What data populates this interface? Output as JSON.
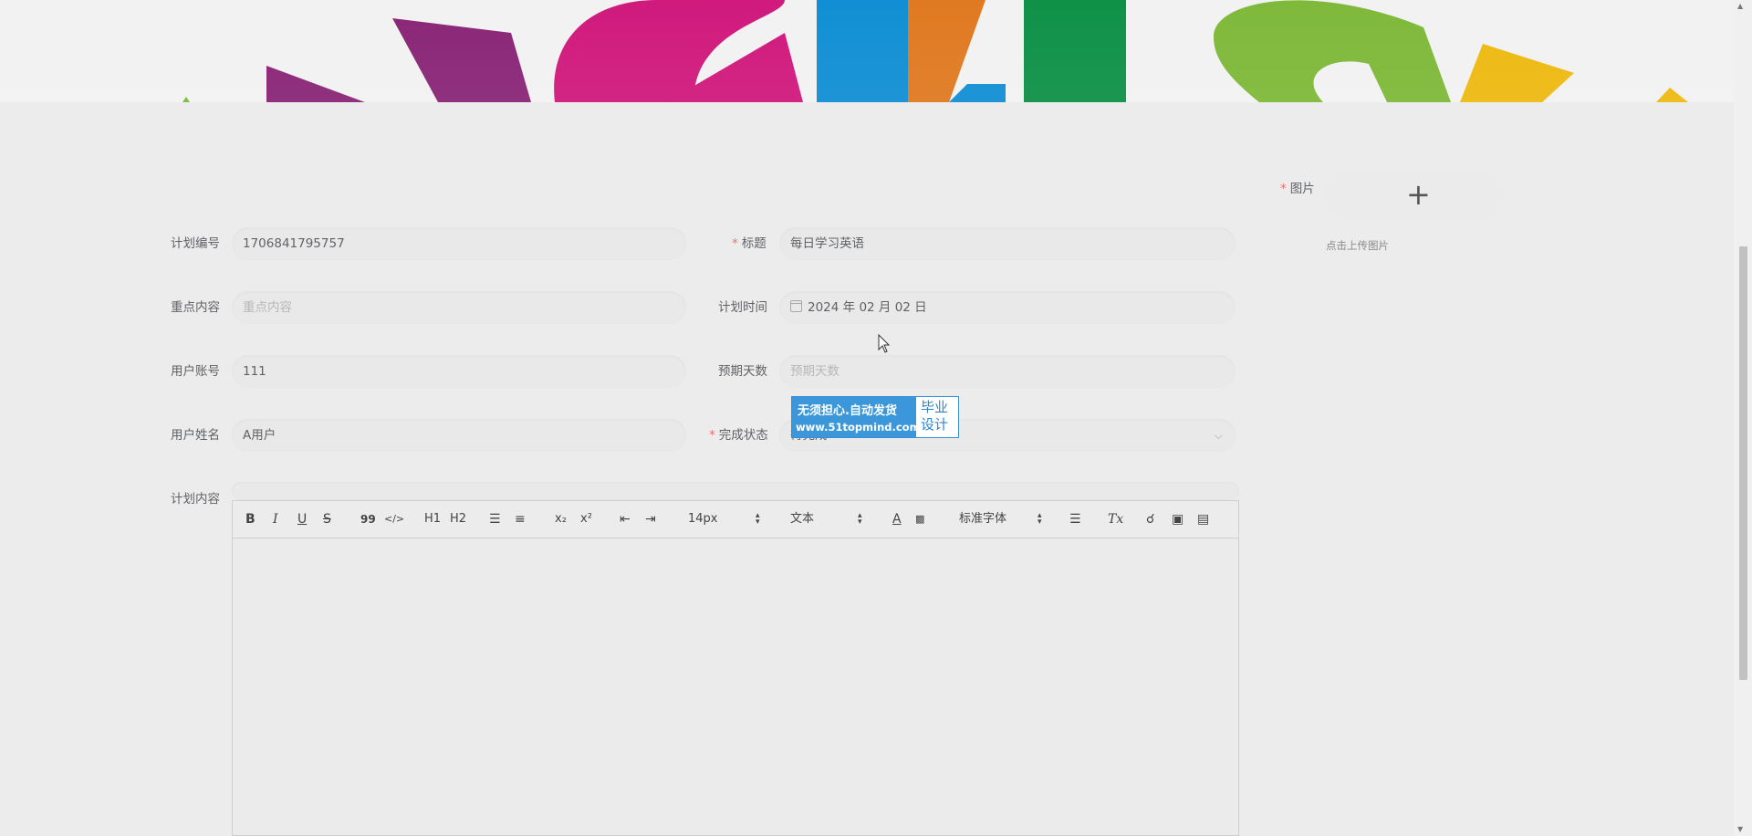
{
  "form": {
    "plan_no": {
      "label": "计划编号",
      "value": "1706841795757"
    },
    "title": {
      "label": "标题",
      "value": "每日学习英语",
      "required": true
    },
    "key_content": {
      "label": "重点内容",
      "placeholder": "重点内容"
    },
    "plan_time": {
      "label": "计划时间",
      "value": "2024 年 02 月 02 日"
    },
    "user_account": {
      "label": "用户账号",
      "value": "111"
    },
    "expected_days": {
      "label": "预期天数",
      "placeholder": "预期天数"
    },
    "user_name": {
      "label": "用户姓名",
      "value": "A用户"
    },
    "status": {
      "label": "完成状态",
      "value": "待完成",
      "required": true
    },
    "image": {
      "label": "图片",
      "required": true,
      "plus": "+",
      "hint": "点击上传图片"
    },
    "plan_content": {
      "label": "计划内容"
    }
  },
  "editor_toolbar": {
    "bold": "B",
    "italic": "I",
    "underline": "U",
    "strike": "S",
    "quote": "99",
    "code": "</>",
    "h1": "H1",
    "h2": "H2",
    "sub": "x₂",
    "sup": "x²",
    "size_value": "14px",
    "header_value": "文本",
    "font_value": "标准字体",
    "clean": "Tx"
  },
  "watermark": {
    "line1": "无须担心.自动发货",
    "line2": "www.51topmind.com",
    "right1": "毕业",
    "right2": "设计"
  },
  "colors": {
    "required": "#f56c6c",
    "watermark_blue": "#3b97d9",
    "banner_magenta": "#d01a7d",
    "banner_purple": "#8a2677",
    "banner_blue": "#118fd4",
    "banner_orange": "#e07a22",
    "banner_green": "#0f9148",
    "banner_lime": "#7fb93a",
    "banner_yellow": "#edba12"
  }
}
